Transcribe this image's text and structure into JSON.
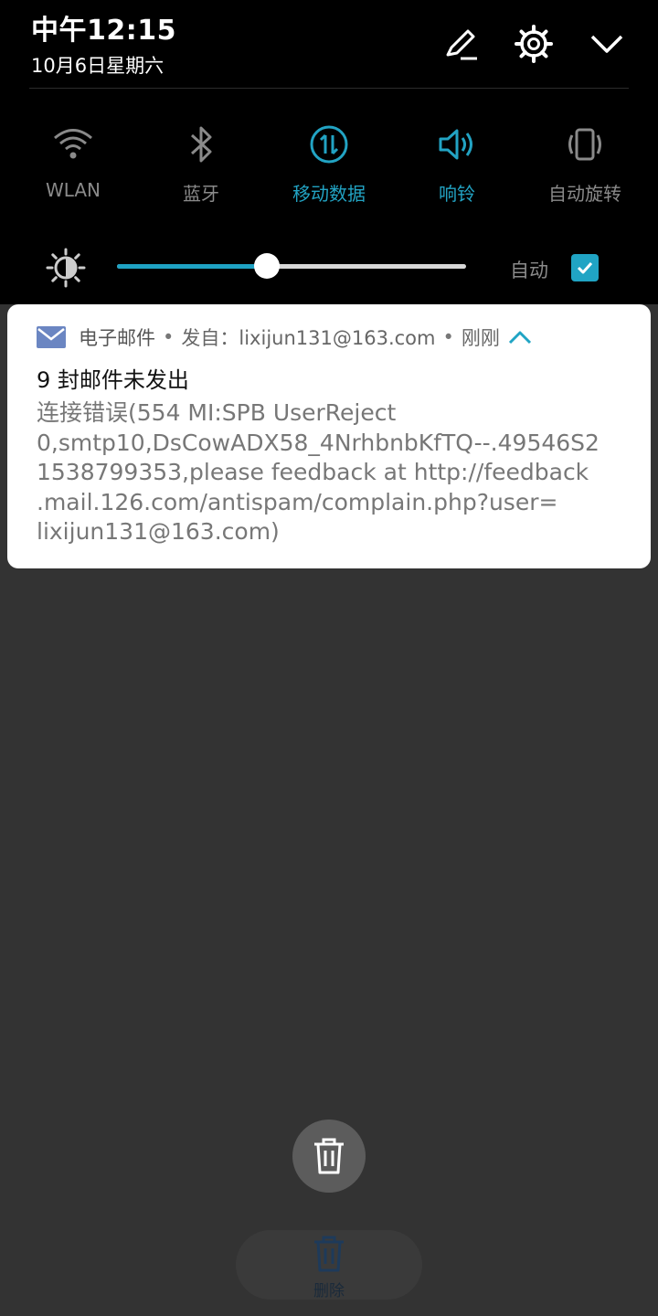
{
  "status": {
    "time": "中午12:15",
    "date": "10月6日星期六"
  },
  "header_icons": [
    "edit-icon",
    "settings-gear-icon",
    "collapse-chevron-icon"
  ],
  "quick_tiles": [
    {
      "label": "WLAN",
      "icon": "wifi-icon",
      "active": false
    },
    {
      "label": "蓝牙",
      "icon": "bluetooth-icon",
      "active": false
    },
    {
      "label": "移动数据",
      "icon": "mobile-data-icon",
      "active": true
    },
    {
      "label": "响铃",
      "icon": "ringer-icon",
      "active": true
    },
    {
      "label": "自动旋转",
      "icon": "auto-rotate-icon",
      "active": false
    }
  ],
  "brightness": {
    "level": 0.43,
    "auto_label": "自动",
    "auto_checked": true
  },
  "colors": {
    "accent": "#20a4c4",
    "shade_bg": "#000000",
    "screen_bg": "#333333"
  },
  "notification": {
    "app_name": "电子邮件",
    "separator": "•",
    "sender": "发自：lixijun131@163.com",
    "time": "刚刚",
    "title": "9 封邮件未发出",
    "body": "连接错误(554 MI:SPB UserReject\n0,smtp10,DsCowADX58_4NrhbnbKfTQ--.49546S2\n1538799353,please feedback at http://feedback\n.mail.126.com/antispam/complain.php?user=\nlixijun131@163.com)"
  },
  "clear_all_icon": "trash-icon",
  "dock": {
    "label": "删除",
    "icon": "trash-icon"
  }
}
